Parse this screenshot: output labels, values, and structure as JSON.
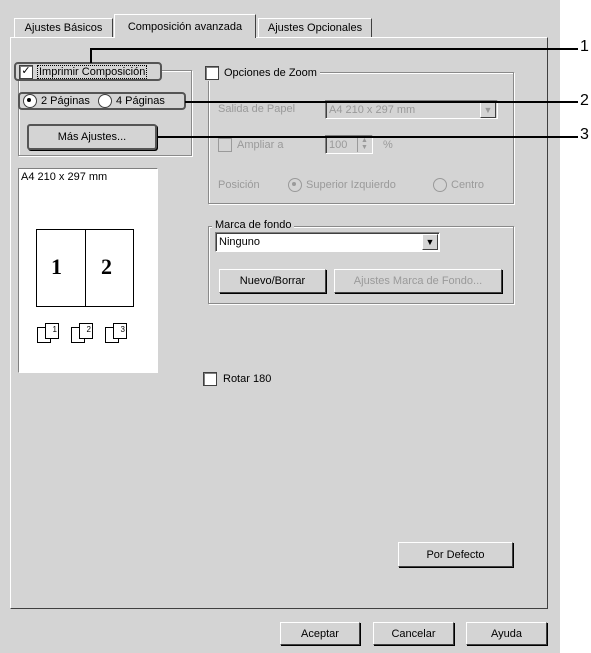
{
  "tabs": [
    {
      "label": "Ajustes Básicos"
    },
    {
      "label": "Composición avanzada"
    },
    {
      "label": "Ajustes Opcionales"
    }
  ],
  "layout": {
    "print_layout_label": "Imprimir Composición",
    "pages_2_label": "2 Páginas",
    "pages_4_label": "4 Páginas",
    "more_settings_label": "Más Ajustes..."
  },
  "preview": {
    "paper_label": "A4 210 x 297 mm",
    "page1": "1",
    "page2": "2",
    "stack": [
      "1",
      "2",
      "3"
    ]
  },
  "zoom": {
    "legend": "Opciones de Zoom",
    "paper_output_label": "Salida de Papel",
    "paper_output_value": "A4 210 x 297 mm",
    "enlarge_label": "Ampliar a",
    "enlarge_value": "100",
    "enlarge_unit": "%",
    "position_label": "Posición",
    "position_top_left": "Superior Izquierdo",
    "position_center": "Centro"
  },
  "watermark": {
    "legend": "Marca de fondo",
    "selected": "Ninguno",
    "new_delete_label": "Nuevo/Borrar",
    "settings_label": "Ajustes Marca de Fondo..."
  },
  "rotate_label": "Rotar 180",
  "default_label": "Por Defecto",
  "footer": {
    "ok_label": "Aceptar",
    "cancel_label": "Cancelar",
    "help_label": "Ayuda"
  },
  "callouts": [
    "1",
    "2",
    "3"
  ]
}
